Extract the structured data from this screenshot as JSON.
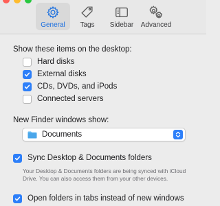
{
  "window": {
    "traffic_colors": [
      "#ff5f57",
      "#febc2e",
      "#28c840"
    ]
  },
  "toolbar": {
    "tabs": [
      {
        "label": "General",
        "icon": "gear-icon",
        "active": true
      },
      {
        "label": "Tags",
        "icon": "tag-icon",
        "active": false
      },
      {
        "label": "Sidebar",
        "icon": "sidebar-icon",
        "active": false
      },
      {
        "label": "Advanced",
        "icon": "gears-icon",
        "active": false
      }
    ]
  },
  "desktop": {
    "heading": "Show these items on the desktop:",
    "items": [
      {
        "label": "Hard disks",
        "checked": false
      },
      {
        "label": "External disks",
        "checked": true
      },
      {
        "label": "CDs, DVDs, and iPods",
        "checked": true
      },
      {
        "label": "Connected servers",
        "checked": false
      }
    ]
  },
  "new_window": {
    "heading": "New Finder windows show:",
    "selected": "Documents"
  },
  "sync": {
    "label": "Sync Desktop & Documents folders",
    "checked": true,
    "note": "Your Desktop & Documents folders are being synced with iCloud Drive. You can also access them from your other devices."
  },
  "open_tabs": {
    "label": "Open folders in tabs instead of new windows",
    "checked": true
  },
  "colors": {
    "accent": "#2d7ff9",
    "active_tab_text": "#1a6fe0"
  }
}
